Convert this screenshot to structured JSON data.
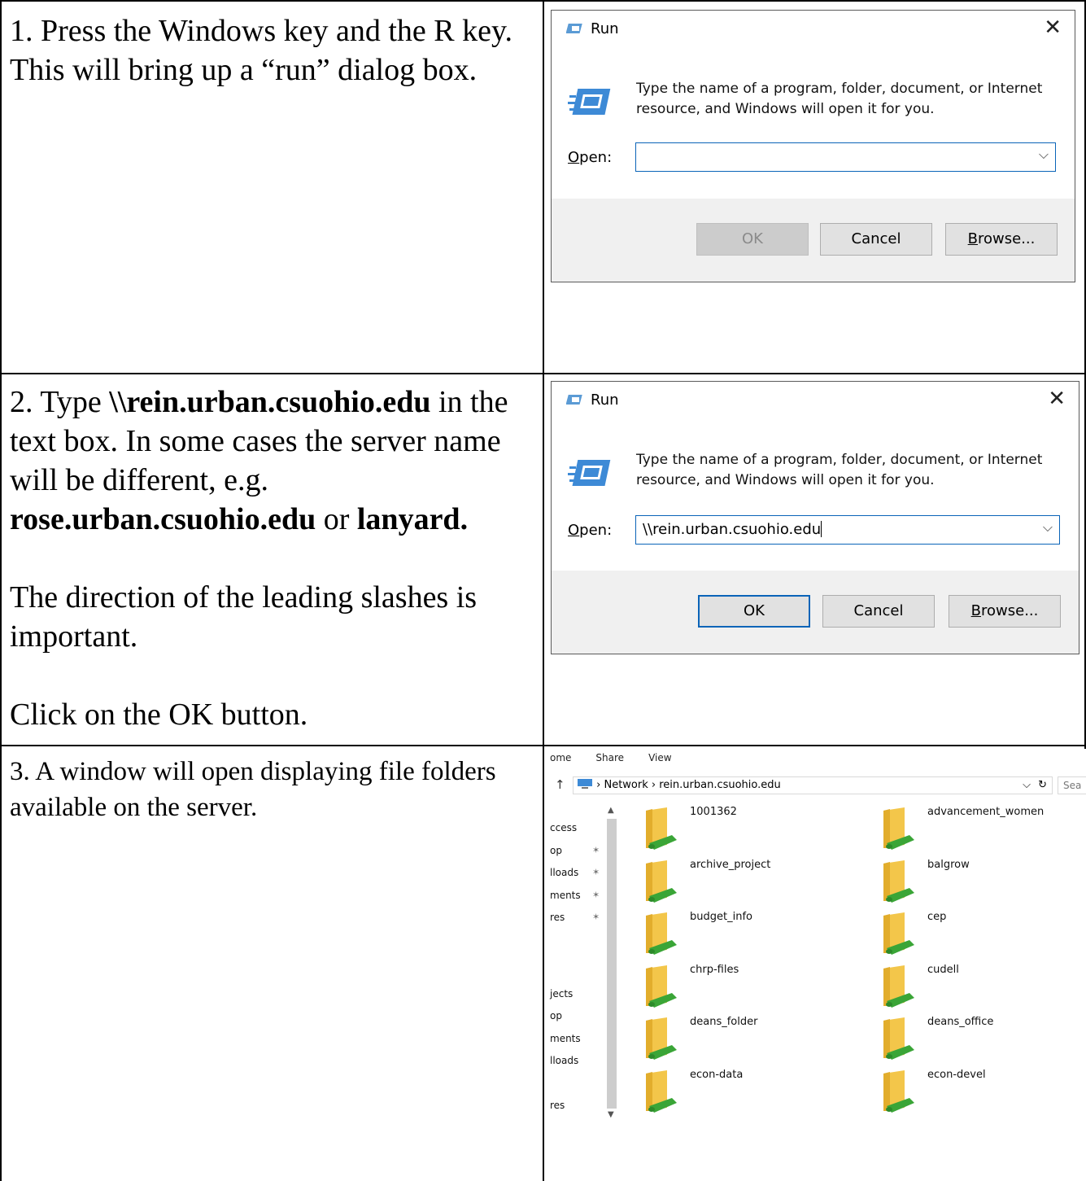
{
  "steps": [
    {
      "number": "1.",
      "text": "Press the Windows key and the R key.  This will bring up a “run” dialog box."
    },
    {
      "number": "2.",
      "text_a": "Type ",
      "bold_a": "\\\\rein.urban.csuohio.edu",
      "text_b": " in the text box.  In some cases the server name will be different, e.g. ",
      "bold_b": "rose.urban.csuohio.edu",
      "text_c": " or ",
      "bold_c": "lanyard.",
      "para2": "The direction of the leading slashes is important.",
      "para3": "Click on the OK button."
    },
    {
      "number": "3.",
      "text": "A window will open displaying file folders available on the server."
    }
  ],
  "run_dialog_1": {
    "title": "Run",
    "description": "Type the name of a program, folder, document, or Internet resource, and Windows will open it for you.",
    "open_label_u": "O",
    "open_label_rest": "pen:",
    "input_value": "",
    "ok": "OK",
    "cancel": "Cancel",
    "browse_u": "B",
    "browse_rest": "rowse..."
  },
  "run_dialog_2": {
    "title": "Run",
    "description": "Type the name of a program, folder, document, or Internet resource, and Windows will open it for you.",
    "open_label_u": "O",
    "open_label_rest": "pen:",
    "input_value": "\\\\rein.urban.csuohio.edu",
    "ok": "OK",
    "cancel": "Cancel",
    "browse_u": "B",
    "browse_rest": "rowse..."
  },
  "explorer": {
    "menu": [
      "ome",
      "Share",
      "View"
    ],
    "path_network": "Network",
    "path_server": "rein.urban.csuohio.edu",
    "search": "Sea",
    "nav_items": [
      "ccess",
      "op",
      "lloads",
      "ments",
      "res",
      "",
      "",
      "jects",
      "op",
      "ments",
      "lloads",
      "",
      "res"
    ],
    "folders": [
      "1001362",
      "advancement_women",
      "archive_project",
      "balgrow",
      "budget_info",
      "cep",
      "chrp-files",
      "cudell",
      "deans_folder",
      "deans_office",
      "econ-data",
      "econ-devel"
    ]
  },
  "colors": {
    "accent": "#0a64b8",
    "folder": "#f3c64a",
    "network_green": "#3aa537"
  }
}
